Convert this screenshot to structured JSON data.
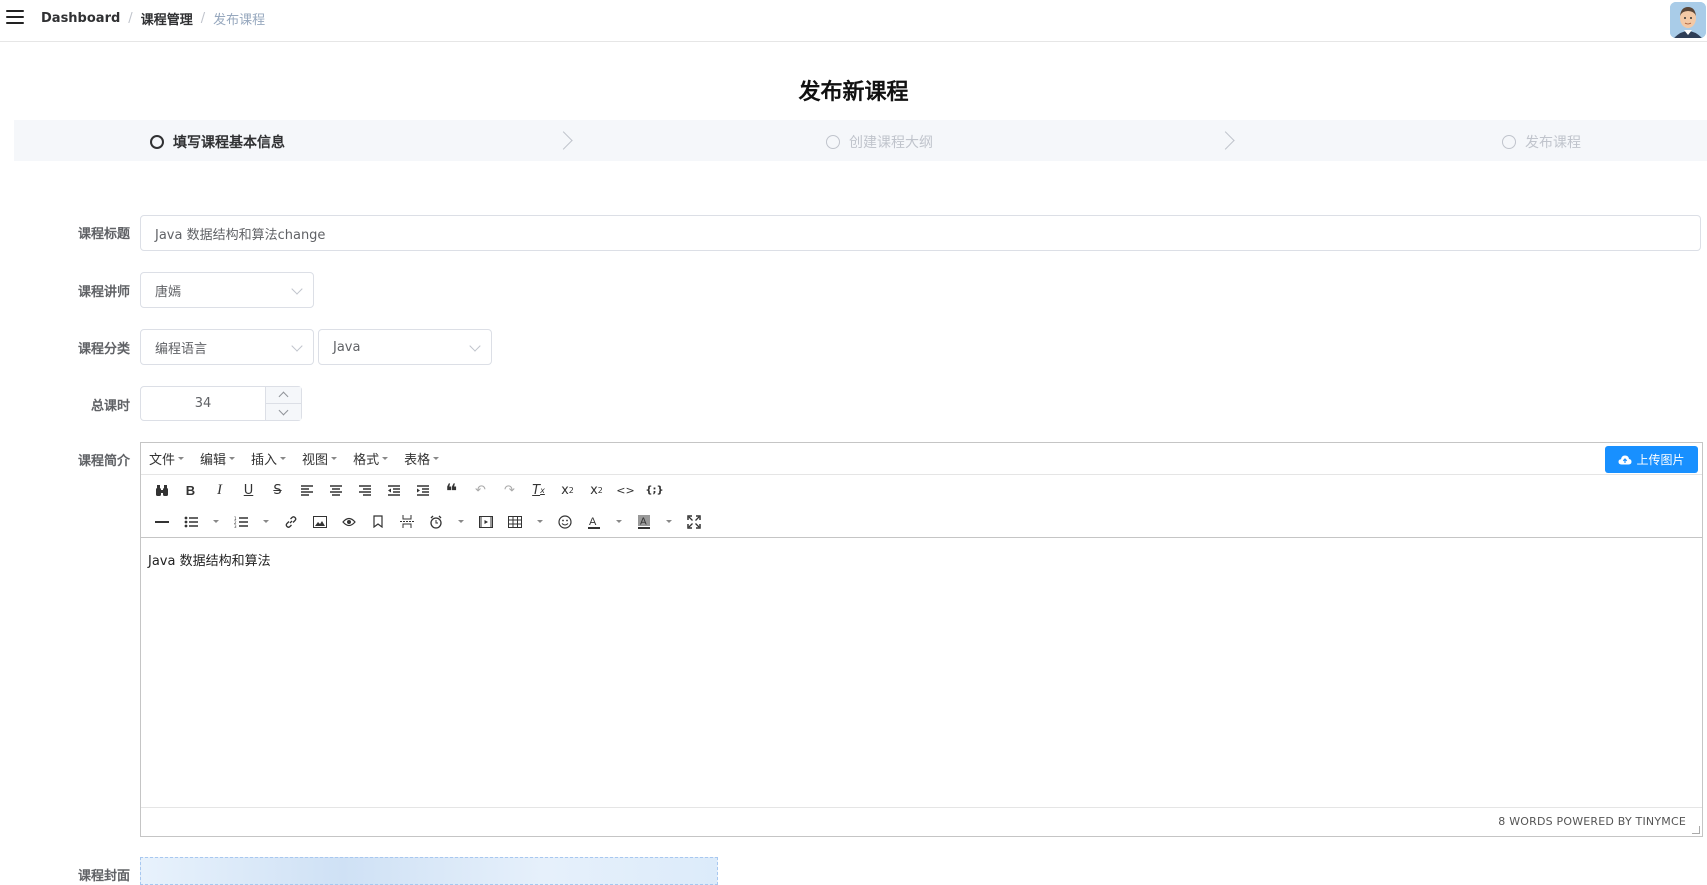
{
  "breadcrumb": {
    "items": [
      "Dashboard",
      "课程管理"
    ],
    "current": "发布课程",
    "separator": "/"
  },
  "page": {
    "title": "发布新课程"
  },
  "steps": [
    {
      "label": "填写课程基本信息",
      "state": "active"
    },
    {
      "label": "创建课程大纲",
      "state": "pending"
    },
    {
      "label": "发布课程",
      "state": "pending"
    }
  ],
  "form": {
    "title_label": "课程标题",
    "title_value": "Java 数据结构和算法change",
    "teacher_label": "课程讲师",
    "teacher_value": "唐嫣",
    "category_label": "课程分类",
    "category_primary": "编程语言",
    "category_secondary": "Java",
    "hours_label": "总课时",
    "hours_value": "34",
    "desc_label": "课程简介",
    "cover_label": "课程封面"
  },
  "editor": {
    "menu": [
      "文件",
      "编辑",
      "插入",
      "视图",
      "格式",
      "表格"
    ],
    "upload_label": "上传图片",
    "content": "Java 数据结构和算法",
    "status": "8 WORDS POWERED BY TINYMCE",
    "toolbar1": [
      "binoculars-icon",
      "bold-icon",
      "italic-icon",
      "underline-icon",
      "strikethrough-icon",
      "align-left-icon",
      "align-center-icon",
      "align-right-icon",
      "outdent-icon",
      "indent-icon",
      "blockquote-icon",
      "undo-icon",
      "redo-icon",
      "remove-format-icon",
      "subscript-icon",
      "superscript-icon",
      "code-icon",
      "codesample-icon"
    ],
    "toolbar2": [
      "hr-icon",
      "bullet-list-icon",
      "numbered-list-icon",
      "link-icon",
      "image-icon",
      "preview-icon",
      "anchor-icon",
      "page-break-icon",
      "insert-time-icon",
      "media-icon",
      "table-icon",
      "emoticons-icon",
      "text-color-icon",
      "background-color-icon",
      "fullscreen-icon"
    ]
  },
  "colors": {
    "primary": "#1890ff",
    "step_bg": "#f5f7fa",
    "pending": "#c0c4cc"
  }
}
